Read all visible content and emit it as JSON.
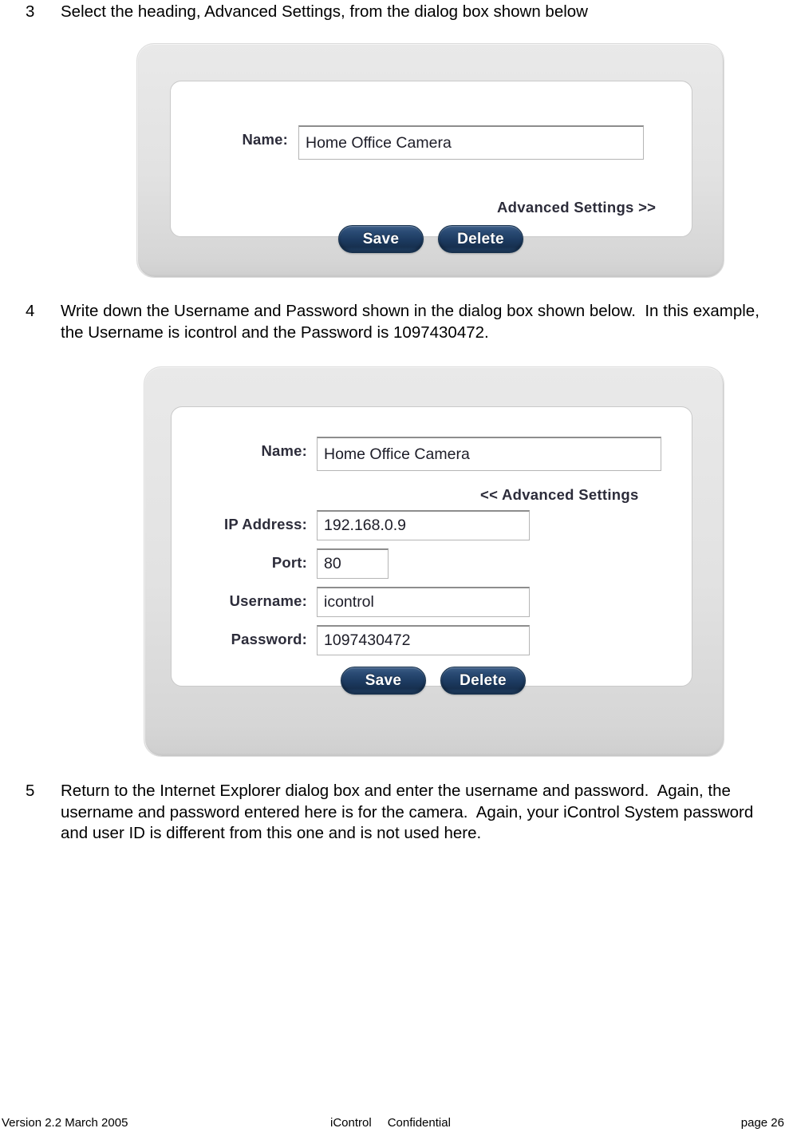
{
  "steps": [
    {
      "number": "3",
      "text": "Select the heading, Advanced Settings, from the dialog box shown below"
    },
    {
      "number": "4",
      "text": "Write down the Username and Password shown in the dialog box shown below.  In this example, the Username is icontrol and the Password is 1097430472."
    },
    {
      "number": "5",
      "text": "Return to the Internet Explorer dialog box and enter the username and password.  Again, the username and password entered here is for the camera.  Again, your iControl System password and user ID is different from this one and is not used here."
    }
  ],
  "dialog_collapsed": {
    "name_label": "Name:",
    "name_value": "Home Office Camera",
    "advanced_toggle": "Advanced Settings >>",
    "save_label": "Save",
    "delete_label": "Delete"
  },
  "dialog_expanded": {
    "name_label": "Name:",
    "name_value": "Home Office Camera",
    "advanced_toggle": "<< Advanced Settings",
    "ip_label": "IP Address:",
    "ip_value": "192.168.0.9",
    "port_label": "Port:",
    "port_value": "80",
    "username_label": "Username:",
    "username_value": "icontrol",
    "password_label": "Password:",
    "password_value": "1097430472",
    "save_label": "Save",
    "delete_label": "Delete"
  },
  "footer": {
    "version": "Version 2.2 March 2005",
    "company": "iControl",
    "classification": "Confidential",
    "page": "page 26"
  },
  "colors": {
    "button_navy": "#1c3a60",
    "panel_gray": "#e2e2e2",
    "panel_white": "#ffffff",
    "label_ink": "#2c2c3a"
  }
}
